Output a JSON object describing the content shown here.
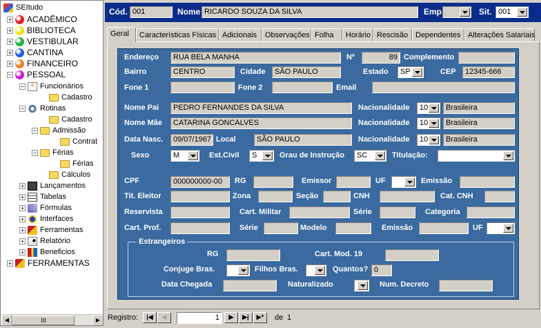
{
  "tree": {
    "root": "SEItudo",
    "nodes": [
      {
        "label": "ACADÊMICO",
        "icon": "red-ball-icon",
        "color": "#e02020"
      },
      {
        "label": "BIBLIOTECA",
        "icon": "yellow-ball-icon",
        "color": "#f0e020"
      },
      {
        "label": "VESTIBULAR",
        "icon": "green-ball-icon",
        "color": "#20b040"
      },
      {
        "label": "CANTINA",
        "icon": "blue-ball-icon",
        "color": "#2060e0"
      },
      {
        "label": "FINANCEIRO",
        "icon": "orange-ball-icon",
        "color": "#f08020"
      },
      {
        "label": "PESSOAL",
        "icon": "magenta-ball-icon",
        "color": "#d020d0"
      },
      {
        "label": "Funcionários"
      },
      {
        "label": "Cadastro"
      },
      {
        "label": "Rotinas"
      },
      {
        "label": "Cadastro"
      },
      {
        "label": "Admissão"
      },
      {
        "label": "Contrat"
      },
      {
        "label": "Férias"
      },
      {
        "label": "Férias"
      },
      {
        "label": "Cálculos"
      },
      {
        "label": "Lançamentos"
      },
      {
        "label": "Tabelas"
      },
      {
        "label": "Fórmulas"
      },
      {
        "label": "Interfaces"
      },
      {
        "label": "Ferramentas"
      },
      {
        "label": "Relatório"
      },
      {
        "label": "Beneficios"
      },
      {
        "label": "FERRAMENTAS"
      }
    ],
    "scroll_grip": "III"
  },
  "header": {
    "cod_label": "Cód.",
    "cod_value": "001",
    "nome_label": "Nome",
    "nome_value": "RICARDO SOUZA DA SILVA",
    "emp_label": "Emp.",
    "emp_value": "",
    "sit_label": "Sit.",
    "sit_value": "001"
  },
  "tabs": [
    "Geral",
    "Características Físicas",
    "Adicionais",
    "Observações",
    "Folha",
    "Horário",
    "Rescisão",
    "Dependentes",
    "Alterações Salariais"
  ],
  "form": {
    "endereco_label": "Endereço",
    "endereco": "RUA BELA MANHA",
    "numero_label": "Nº",
    "numero": "89",
    "complemento_label": "Complemento",
    "complemento": "",
    "bairro_label": "Bairro",
    "bairro": "CENTRO",
    "cidade_label": "Cidade",
    "cidade": "SÃO PAULO",
    "estado_label": "Estado",
    "estado": "SP",
    "cep_label": "CEP",
    "cep": "12345-666",
    "fone1_label": "Fone 1",
    "fone2_label": "Fone 2",
    "email_label": "Email",
    "nome_pai_label": "Nome Pai",
    "nome_pai": "PEDRO FERNANDES DA SILVA",
    "nome_mae_label": "Nome Mãe",
    "nome_mae": "CATARINA GONCALVES",
    "nacionalidade_label": "Nacionalidade",
    "nac_code": "10",
    "nac_name": "Brasileira",
    "data_nasc_label": "Data Nasc.",
    "data_nasc": "09/07/1967",
    "local_label": "Local",
    "local": "SÃO PAULO",
    "sexo_label": "Sexo",
    "sexo": "M",
    "est_civil_label": "Est.Civil",
    "est_civil": "S",
    "grau_label": "Grau de Instrução",
    "grau": "SC",
    "titulacao_label": "Titulação:",
    "cpf_label": "CPF",
    "cpf": "000000000-00",
    "rg_label": "RG",
    "emissor_label": "Emissor",
    "uf_label": "UF",
    "emissao_label": "Emissão",
    "tit_eleitor_label": "Tit. Eleitor",
    "zona_label": "Zona",
    "secao_label": "Seção",
    "cnh_label": "CNH",
    "cat_cnh_label": "Cat. CNH",
    "reservista_label": "Reservista",
    "cart_militar_label": "Cart. Militar",
    "serie_label": "Série",
    "categoria_label": "Categoria",
    "cart_prof_label": "Cart. Prof.",
    "modelo_label": "Modelo",
    "estrangeiros_label": "Estrangeiros",
    "cart_mod19_label": "Cart. Mod. 19",
    "conjuge_label": "Conjuge Bras.",
    "filhos_label": "Filhos Bras.",
    "quantos_label": "Quantos?",
    "quantos": "0",
    "data_chegada_label": "Data Chegada",
    "naturalizado_label": "Naturalizado",
    "num_decreto_label": "Num. Decreto"
  },
  "nav": {
    "registro_label": "Registro:",
    "record": "1",
    "de_label": "de",
    "total": "1"
  }
}
